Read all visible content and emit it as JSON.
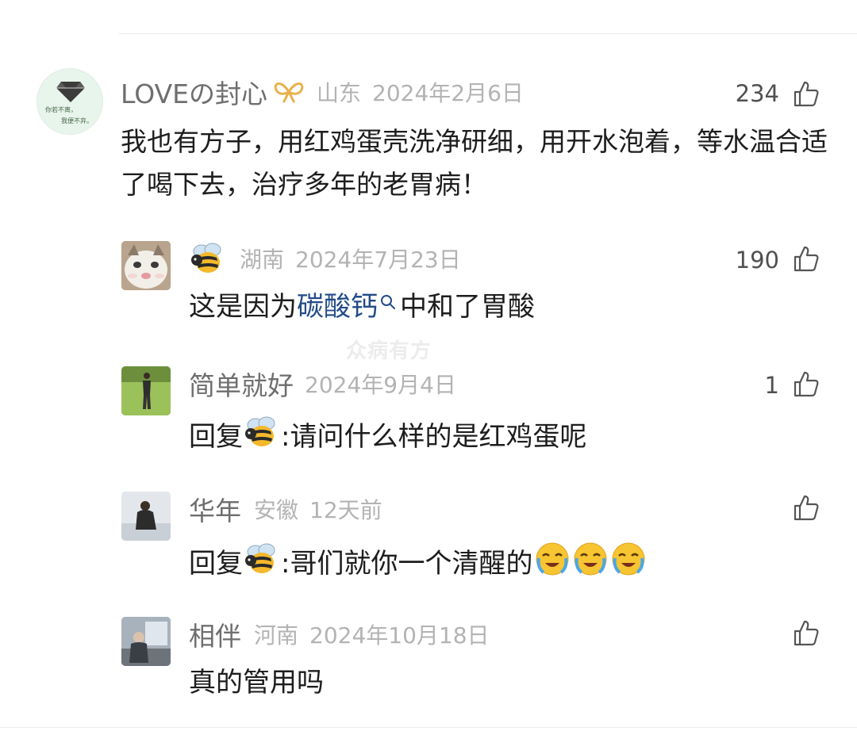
{
  "comments": [
    {
      "username": "LOVEの封心",
      "badge_icon": "ribbon-badge-icon",
      "location": "山东",
      "date": "2024年2月6日",
      "likes": "234",
      "content": "我也有方子，用红鸡蛋壳洗净研细，用开水泡着，等水温合适了喝下去，治疗多年的老胃病！",
      "avatar_text_1": "你若不离，",
      "avatar_text_2": "我便不弃。"
    }
  ],
  "replies": [
    {
      "username_icon": "bee-emoji-icon",
      "location": "湖南",
      "date": "2024年7月23日",
      "likes": "190",
      "content_before": "这是因为",
      "content_link": "碳酸钙",
      "content_after": "中和了胃酸"
    },
    {
      "username": "简单就好",
      "location": "",
      "date": "2024年9月4日",
      "likes": "1",
      "reply_prefix": "回复",
      "content": ":请问什么样的是红鸡蛋呢"
    },
    {
      "username": "华年",
      "location": "安徽",
      "date": "12天前",
      "likes": "",
      "reply_prefix": "回复",
      "content": ":哥们就你一个清醒的"
    },
    {
      "username": "相伴",
      "location": "河南",
      "date": "2024年10月18日",
      "likes": "",
      "content": "真的管用吗"
    }
  ],
  "watermark": "众病有方",
  "colors": {
    "link": "#224b88",
    "username": "#6e6e6e",
    "meta": "#b3b3b3"
  }
}
